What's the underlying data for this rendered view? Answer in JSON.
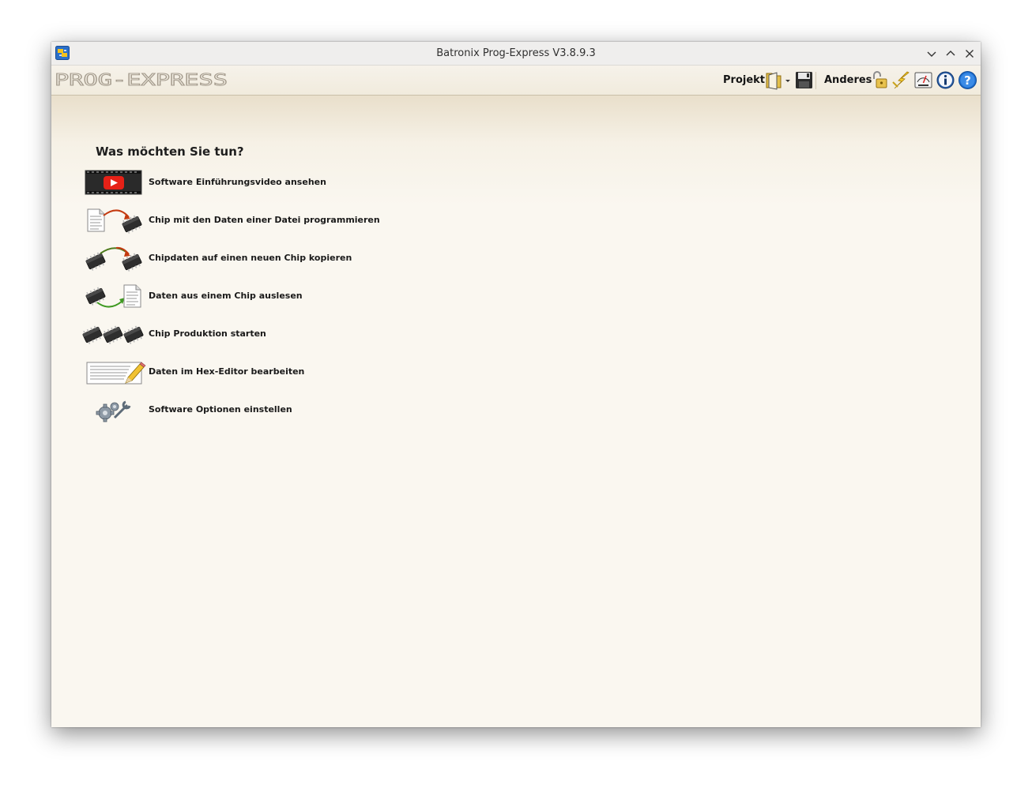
{
  "window": {
    "title": "Batronix Prog-Express V3.8.9.3",
    "controls": [
      "minimize-icon",
      "maximize-icon",
      "close-icon"
    ]
  },
  "toolbar": {
    "logo_text": "PROG-EXPRESS",
    "projekt_label": "Projekt",
    "anderes_label": "Anderes",
    "icons": [
      "open-folder-icon",
      "dropdown-arrow-icon",
      "save-icon",
      "lock-icon",
      "flash-icon",
      "meter-icon",
      "info-icon",
      "help-icon"
    ]
  },
  "main": {
    "heading": "Was möchten Sie tun?",
    "actions": [
      {
        "label": "Software Einführungsvideo ansehen",
        "icon": "video-play-icon"
      },
      {
        "label": "Chip mit den Daten einer Datei programmieren",
        "icon": "file-to-chip-icon"
      },
      {
        "label": "Chipdaten auf einen neuen Chip kopieren",
        "icon": "chip-to-chip-icon"
      },
      {
        "label": "Daten aus einem Chip auslesen",
        "icon": "chip-to-file-icon"
      },
      {
        "label": "Chip Produktion starten",
        "icon": "chip-production-icon"
      },
      {
        "label": "Daten im Hex-Editor bearbeiten",
        "icon": "hex-editor-icon"
      },
      {
        "label": "Software Optionen einstellen",
        "icon": "gears-icon"
      }
    ]
  },
  "colors": {
    "background": "#faf7f0",
    "toolbar_border": "#c9bfa9",
    "help_blue": "#1e6fd0",
    "youtube_red": "#e62117"
  }
}
